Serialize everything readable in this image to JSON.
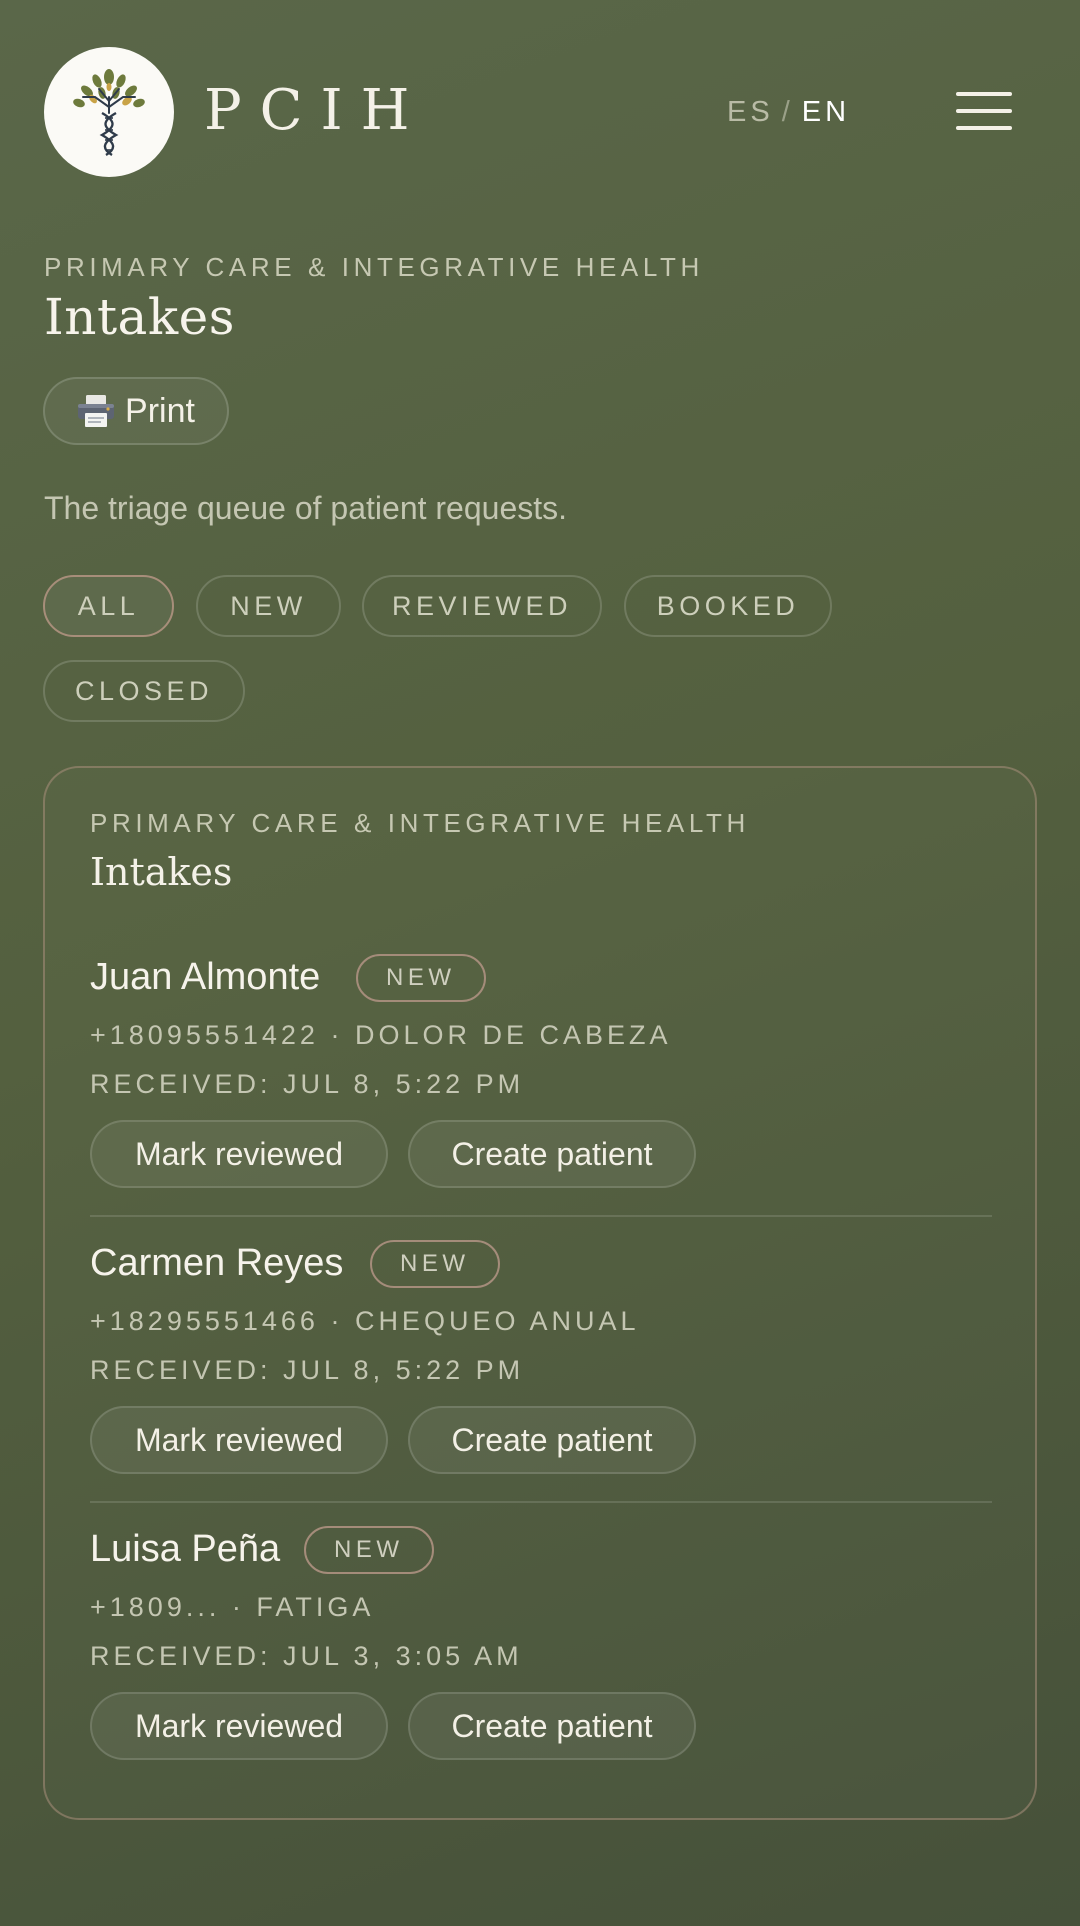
{
  "header": {
    "brand": "PCIH",
    "lang": {
      "es": "ES",
      "separator": "/",
      "en": "EN",
      "active": "EN"
    }
  },
  "page": {
    "eyebrow": "PRIMARY CARE & INTEGRATIVE HEALTH",
    "title": "Intakes",
    "print_label": "Print",
    "subtitle": "The triage queue of patient requests."
  },
  "filters": [
    {
      "label": "ALL",
      "active": true
    },
    {
      "label": "NEW",
      "active": false
    },
    {
      "label": "REVIEWED",
      "active": false
    },
    {
      "label": "BOOKED",
      "active": false
    },
    {
      "label": "CLOSED",
      "active": false
    }
  ],
  "card": {
    "eyebrow": "PRIMARY CARE & INTEGRATIVE HEALTH",
    "title": "Intakes",
    "entries": [
      {
        "name": "Juan Almonte",
        "status": "NEW",
        "contact": "+18095551422 · DOLOR DE CABEZA",
        "received": "RECEIVED: JUL 8, 5:22 PM",
        "mark_label": "Mark reviewed",
        "create_label": "Create patient"
      },
      {
        "name": "Carmen Reyes",
        "status": "NEW",
        "contact": "+18295551466 · CHEQUEO ANUAL",
        "received": "RECEIVED: JUL 8, 5:22 PM",
        "mark_label": "Mark reviewed",
        "create_label": "Create patient"
      },
      {
        "name": "Luisa Peña",
        "status": "NEW",
        "contact": "+1809... · FATIGA",
        "received": "RECEIVED: JUL 3, 3:05 AM",
        "mark_label": "Mark reviewed",
        "create_label": "Create patient"
      }
    ]
  },
  "colors": {
    "background": "#54603f",
    "accent_border": "#a48c7a",
    "text": "#f4f1e8",
    "muted_text": "#c4c6b2"
  },
  "icons": {
    "logo": "tree-dna-icon",
    "menu": "hamburger-menu-icon",
    "print": "printer-icon"
  }
}
